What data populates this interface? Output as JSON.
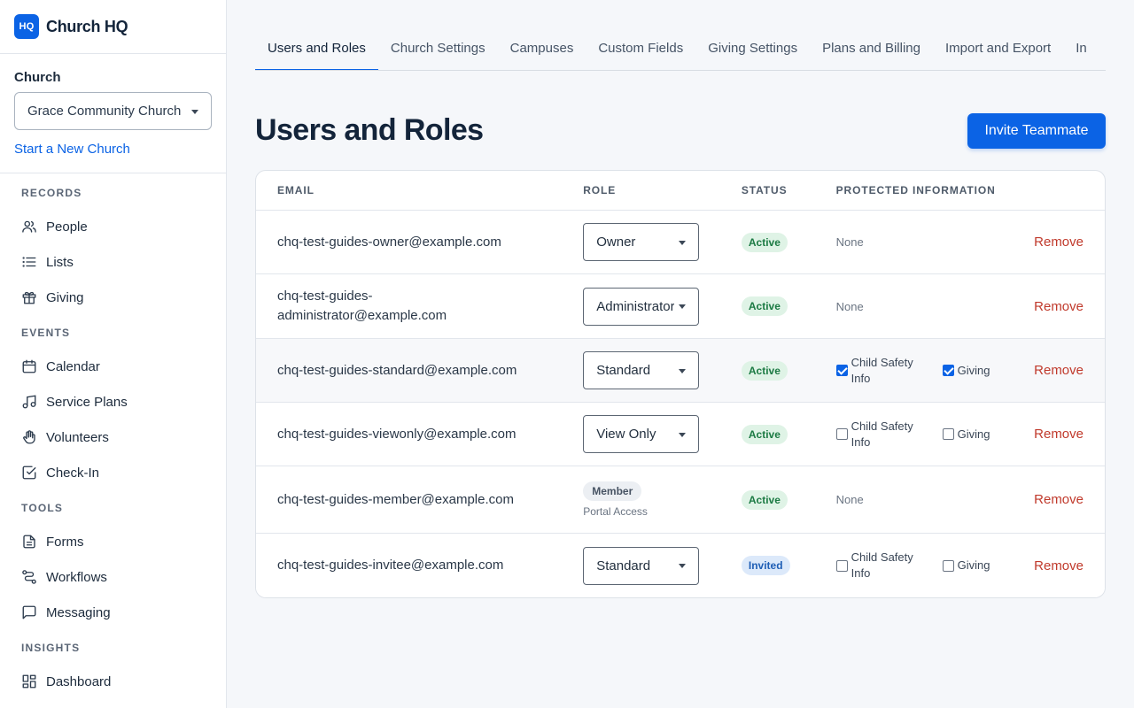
{
  "brand": {
    "logo_text": "HQ",
    "name": "Church HQ"
  },
  "church": {
    "label": "Church",
    "selected": "Grace Community Church",
    "new_link": "Start a New Church"
  },
  "nav": {
    "records": "RECORDS",
    "people": "People",
    "lists": "Lists",
    "giving": "Giving",
    "events": "EVENTS",
    "calendar": "Calendar",
    "service_plans": "Service Plans",
    "volunteers": "Volunteers",
    "checkin": "Check-In",
    "tools": "TOOLS",
    "forms": "Forms",
    "workflows": "Workflows",
    "messaging": "Messaging",
    "insights": "INSIGHTS",
    "dashboard": "Dashboard"
  },
  "tabs": [
    "Users and Roles",
    "Church Settings",
    "Campuses",
    "Custom Fields",
    "Giving Settings",
    "Plans and Billing",
    "Import and Export",
    "In"
  ],
  "page": {
    "title": "Users and Roles",
    "invite_label": "Invite Teammate"
  },
  "table": {
    "headers": {
      "email": "EMAIL",
      "role": "ROLE",
      "status": "STATUS",
      "protected": "PROTECTED INFORMATION"
    },
    "remove_label": "Remove",
    "none_label": "None",
    "child_safety_label": "Child Safety Info",
    "giving_label": "Giving",
    "member_badge": "Member",
    "portal_access": "Portal Access",
    "rows": [
      {
        "email": "chq-test-guides-owner@example.com",
        "role": "Owner",
        "status": "Active",
        "child_safety": null,
        "giving": null
      },
      {
        "email": "chq-test-guides-administrator@example.com",
        "email_line1": "chq-test-guides-",
        "email_line2": "administrator@example.com",
        "role": "Administrator",
        "status": "Active",
        "child_safety": null,
        "giving": null
      },
      {
        "email": "chq-test-guides-standard@example.com",
        "role": "Standard",
        "status": "Active",
        "child_safety": true,
        "giving": true
      },
      {
        "email": "chq-test-guides-viewonly@example.com",
        "role": "View Only",
        "status": "Active",
        "child_safety": false,
        "giving": false
      },
      {
        "email": "chq-test-guides-member@example.com",
        "role": "Member",
        "status": "Active",
        "child_safety": null,
        "giving": null
      },
      {
        "email": "chq-test-guides-invitee@example.com",
        "role": "Standard",
        "status": "Invited",
        "child_safety": false,
        "giving": false
      }
    ]
  },
  "colors": {
    "accent": "#0b63e5",
    "remove": "#c0392b",
    "active_bg": "#dff3e6",
    "invited_bg": "#dce9fa"
  }
}
